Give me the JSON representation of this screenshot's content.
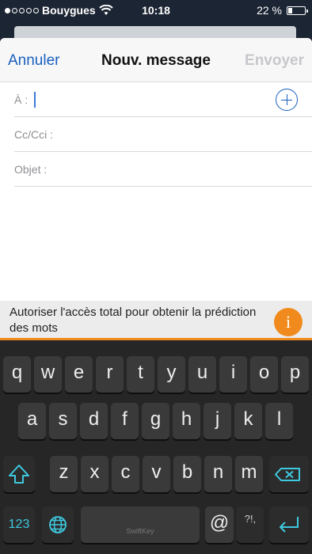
{
  "status_bar": {
    "carrier": "Bouygues",
    "time": "10:18",
    "battery_label": "22 %",
    "battery_level": 0.22,
    "signal_dots_filled": 1
  },
  "compose": {
    "cancel_label": "Annuler",
    "title": "Nouv. message",
    "send_label": "Envoyer",
    "to_label": "À :",
    "cc_label": "Cc/Cci :",
    "subject_label": "Objet :"
  },
  "banner": {
    "text": "Autoriser l'accès total pour obtenir la prédiction des mots",
    "info_label": "i",
    "accent_color": "#f08a1c"
  },
  "keyboard": {
    "row1": [
      "q",
      "w",
      "e",
      "r",
      "t",
      "y",
      "u",
      "i",
      "o",
      "p"
    ],
    "row2": [
      "a",
      "s",
      "d",
      "f",
      "g",
      "h",
      "j",
      "k",
      "l"
    ],
    "row3": [
      "z",
      "x",
      "c",
      "v",
      "b",
      "n",
      "m"
    ],
    "numbers_label": "123",
    "at_label": "@",
    "symbols_label": "?!,",
    "space_brand": "SwiftKey",
    "icons": [
      "shift-icon",
      "backspace-icon",
      "globe-icon",
      "return-icon"
    ]
  }
}
